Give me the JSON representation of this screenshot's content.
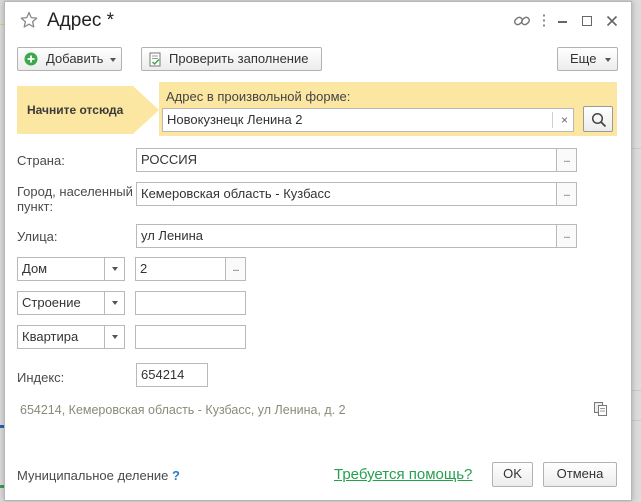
{
  "window": {
    "title": "Адрес *",
    "star_icon": "star-icon",
    "link_icon": "link-icon",
    "more_icon": "vertical-dots-icon",
    "minimize_icon": "minimize-icon",
    "maximize_icon": "maximize-icon",
    "close_icon": "close-icon"
  },
  "toolbar": {
    "add_label": "Добавить",
    "check_label": "Проверить заполнение",
    "more_label": "Еще"
  },
  "hint": {
    "arrow_text": "Начните отсюда",
    "free_form_label": "Адрес в произвольной форме:",
    "free_form_value": "Новокузнецк Ленина 2"
  },
  "fields": {
    "country_label": "Страна:",
    "country_value": "РОССИЯ",
    "city_label_line1": "Город,  населенный",
    "city_label_line2": "пункт:",
    "city_value": "Кемеровская область - Кузбасс",
    "street_label": "Улица:",
    "street_value": "ул Ленина",
    "house_type": "Дом",
    "house_value": "2",
    "building_type": "Строение",
    "building_value": "",
    "apartment_type": "Квартира",
    "apartment_value": "",
    "index_label": "Индекс:",
    "index_value": "654214"
  },
  "result": {
    "full_address": "654214, Кемеровская область - Кузбасс, ул Ленина, д. 2"
  },
  "footer": {
    "municipal_label": "Муниципальное деление",
    "question_mark": "?",
    "help_link": "Требуется помощь?",
    "ok_label": "OK",
    "cancel_label": "Отмена"
  },
  "colors": {
    "hint_background": "#fbe7a1",
    "help_link": "#25a04f",
    "question_mark": "#2a7ec4",
    "add_icon": "#3aa94b"
  }
}
